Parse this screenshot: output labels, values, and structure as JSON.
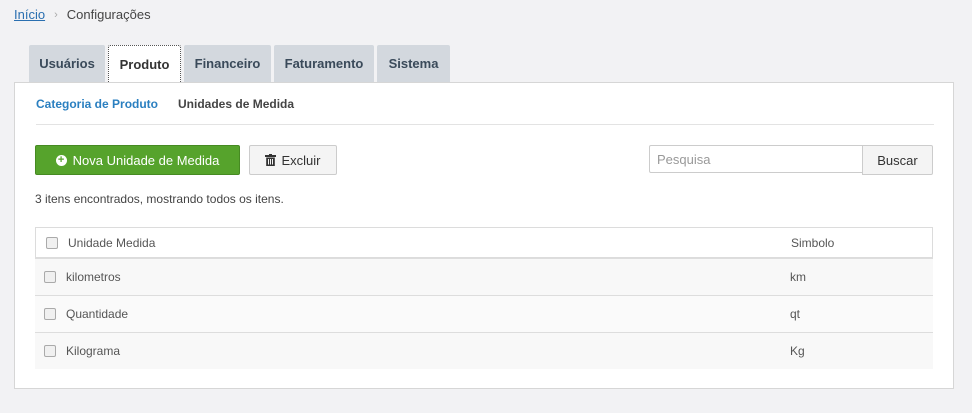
{
  "breadcrumb": {
    "home": "Início",
    "current": "Configurações"
  },
  "tabs": [
    {
      "label": "Usuários",
      "active": false
    },
    {
      "label": "Produto",
      "active": true
    },
    {
      "label": "Financeiro",
      "active": false
    },
    {
      "label": "Faturamento",
      "active": false
    },
    {
      "label": "Sistema",
      "active": false
    }
  ],
  "subtabs": {
    "category": "Categoria de Produto",
    "units": "Unidades de Medida"
  },
  "toolbar": {
    "new_label": "Nova Unidade de Medida",
    "delete_label": "Excluir",
    "search_placeholder": "Pesquisa",
    "search_label": "Buscar"
  },
  "result_text": "3 itens encontrados, mostrando todos os itens.",
  "table": {
    "columns": [
      "Unidade Medida",
      "Simbolo"
    ],
    "rows": [
      [
        "kilometros",
        "km"
      ],
      [
        "Quantidade",
        "qt"
      ],
      [
        "Kilograma",
        "Kg"
      ]
    ]
  },
  "colors": {
    "primary_green": "#56a32c",
    "link_blue": "#2a7fc0",
    "tab_bg": "#d3d8de"
  },
  "icons": {
    "new": "plus-circle-icon",
    "delete": "trash-icon"
  }
}
